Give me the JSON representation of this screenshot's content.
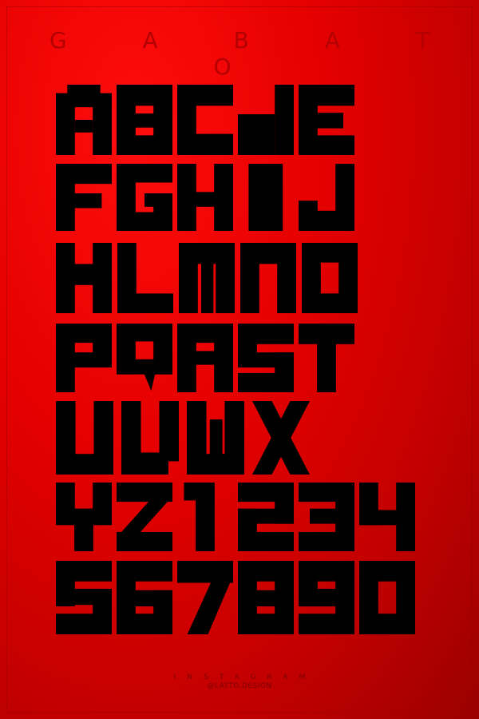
{
  "title": "G A B A T O",
  "rows": [
    [
      "A",
      "B",
      "C",
      "D",
      "E"
    ],
    [
      "F",
      "G",
      "H",
      "I",
      "J"
    ],
    [
      "K",
      "L",
      "M",
      "N",
      "O"
    ],
    [
      "P",
      "Q",
      "R",
      "S",
      "T"
    ],
    [
      "U",
      "V",
      "W",
      "X"
    ],
    [
      "Y",
      "Z",
      "1",
      "2",
      "3",
      "4"
    ],
    [
      "5",
      "6",
      "7",
      "8",
      "9",
      "0"
    ]
  ],
  "footer": {
    "label": "INSTAGRAM",
    "handle": "@LATTO.DESIGN"
  },
  "colors": {
    "background": "#e60000",
    "glyph": "#000000",
    "text": "#b30000"
  }
}
